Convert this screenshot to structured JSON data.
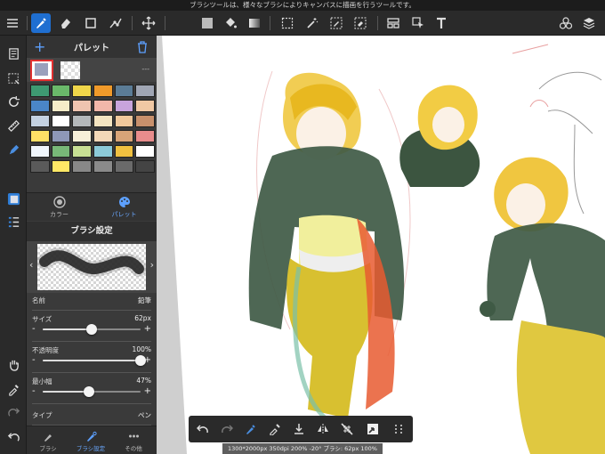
{
  "hint_text": "ブラシツールは、様々なブラシによりキャンバスに描画を行うツールです。",
  "toolbar": {
    "tools": [
      "menu-icon",
      "brush-icon",
      "eraser-icon",
      "rectangle-icon",
      "pen-nodes-icon",
      "move-icon",
      "fill-color-swatch",
      "bucket-icon",
      "gradient-icon",
      "select-rect-icon",
      "magic-wand-icon",
      "select-pen-icon",
      "select-eraser-icon",
      "layout-icon",
      "select-arrow-icon",
      "text-icon",
      "materials-icon",
      "layers-icon"
    ],
    "active": "brush-icon"
  },
  "rail": {
    "tools": [
      "page-icon",
      "lasso-select-icon",
      "rotate-icon",
      "ruler-icon",
      "eyedropper-pen-icon",
      "color-swatch-icon",
      "list-icon",
      "hand-icon",
      "eyedropper-icon",
      "redo-icon",
      "undo-icon"
    ]
  },
  "palette": {
    "title": "パレット",
    "selected_dash": "---",
    "colors": [
      "#3e9a72",
      "#6ab86a",
      "#f0d64a",
      "#f09a2a",
      "#5b7c96",
      "#a0a6b4",
      "#4a86c8",
      "#f6ecc8",
      "#efc4b0",
      "#f2b7aa",
      "#c8a4dc",
      "#f0c8a4",
      "#c4d2e2",
      "#ffffff",
      "#b4b8ba",
      "#f4e4c0",
      "#f0c89c",
      "#c8906c",
      "#ffe066",
      "#8e98b8",
      "#f7f0d8",
      "#f3d8b8",
      "#d8a478",
      "#e88c8c",
      "#f0f6fc",
      "#78b878",
      "#c8e094",
      "#8ccad8",
      "#f0c040",
      "#ffffff",
      "#5a5a5a",
      "#ffe866",
      "#888888",
      "#8a8a8a",
      "#6a6a6a",
      "#444444"
    ]
  },
  "color_tabs": [
    {
      "label": "カラー",
      "active": false
    },
    {
      "label": "パレット",
      "active": true
    }
  ],
  "brush_settings": {
    "title": "ブラシ設定",
    "name_label": "名前",
    "name_value": "鉛筆",
    "size_label": "サイズ",
    "size_value": "62px",
    "size_fraction": 0.5,
    "opacity_label": "不透明度",
    "opacity_value": "100%",
    "opacity_fraction": 1.0,
    "min_width_label": "最小幅",
    "min_width_value": "47%",
    "min_width_fraction": 0.47,
    "type_label": "タイプ",
    "type_value": "ペン",
    "minus": "-",
    "plus": "+"
  },
  "panel_tabs": [
    {
      "label": "ブラシ",
      "active": false
    },
    {
      "label": "ブラシ設定",
      "active": true
    },
    {
      "label": "その他",
      "active": false
    }
  ],
  "bottom_tools": [
    "undo-icon",
    "redo-icon",
    "brush-smooth-icon",
    "eyedropper-icon",
    "save-icon",
    "flip-icon",
    "snap-off-icon",
    "transform-icon",
    "grid-dots-icon"
  ],
  "canvas_info": "1300*2000px 350dpi 200% -20° ブラシ: 62px 100%"
}
